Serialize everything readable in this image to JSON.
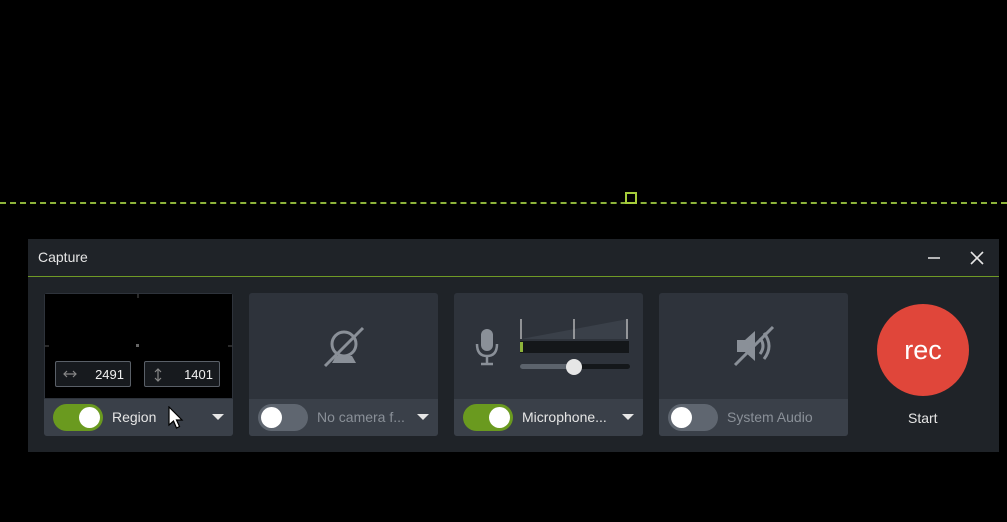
{
  "window": {
    "title": "Capture"
  },
  "region": {
    "width": "2491",
    "height": "1401",
    "toggle_on": true,
    "label": "Region"
  },
  "camera": {
    "toggle_on": false,
    "label": "No camera f..."
  },
  "microphone": {
    "toggle_on": true,
    "label": "Microphone...",
    "volume_level": 0.5
  },
  "system_audio": {
    "toggle_on": false,
    "label": "System Audio"
  },
  "record": {
    "button_label": "rec",
    "start_label": "Start"
  },
  "colors": {
    "accent_green": "#6a9a1f",
    "record_red": "#e0463a",
    "panel": "#1f2328",
    "card": "#2e333b"
  },
  "icons": [
    "minimize-icon",
    "close-icon",
    "width-arrow-icon",
    "height-arrow-icon",
    "camera-off-icon",
    "microphone-icon",
    "speaker-muted-icon",
    "dropdown-caret-icon",
    "mouse-cursor-icon"
  ]
}
